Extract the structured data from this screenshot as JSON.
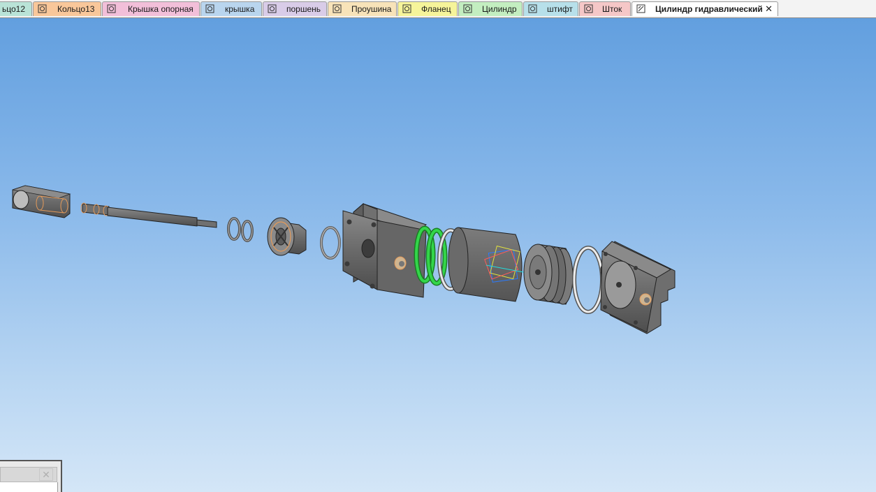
{
  "tabs": [
    {
      "label": "ьцо12",
      "color": "#b9e3d7"
    },
    {
      "label": "Кольцо13",
      "color": "#f9c79a"
    },
    {
      "label": "Крышка опорная",
      "color": "#f2bfd9"
    },
    {
      "label": "крышка",
      "color": "#b9d5ee"
    },
    {
      "label": "поршень",
      "color": "#d9cce8"
    },
    {
      "label": "Проушина",
      "color": "#f8e3b9"
    },
    {
      "label": "Фланец",
      "color": "#f6f49a"
    },
    {
      "label": "Цилиндр",
      "color": "#c3eec0"
    },
    {
      "label": "штифт",
      "color": "#b7e0ea"
    },
    {
      "label": "Шток",
      "color": "#f5c7c7"
    },
    {
      "label": "Цилиндр гидравлический",
      "color": "#ffffff",
      "active": true,
      "close": "✕"
    }
  ],
  "viewport": {
    "background_top": "#629fdf",
    "background_bottom": "#d4e6f7",
    "part_color": "#6d6d6d",
    "ring_highlight": "#33d64a"
  }
}
